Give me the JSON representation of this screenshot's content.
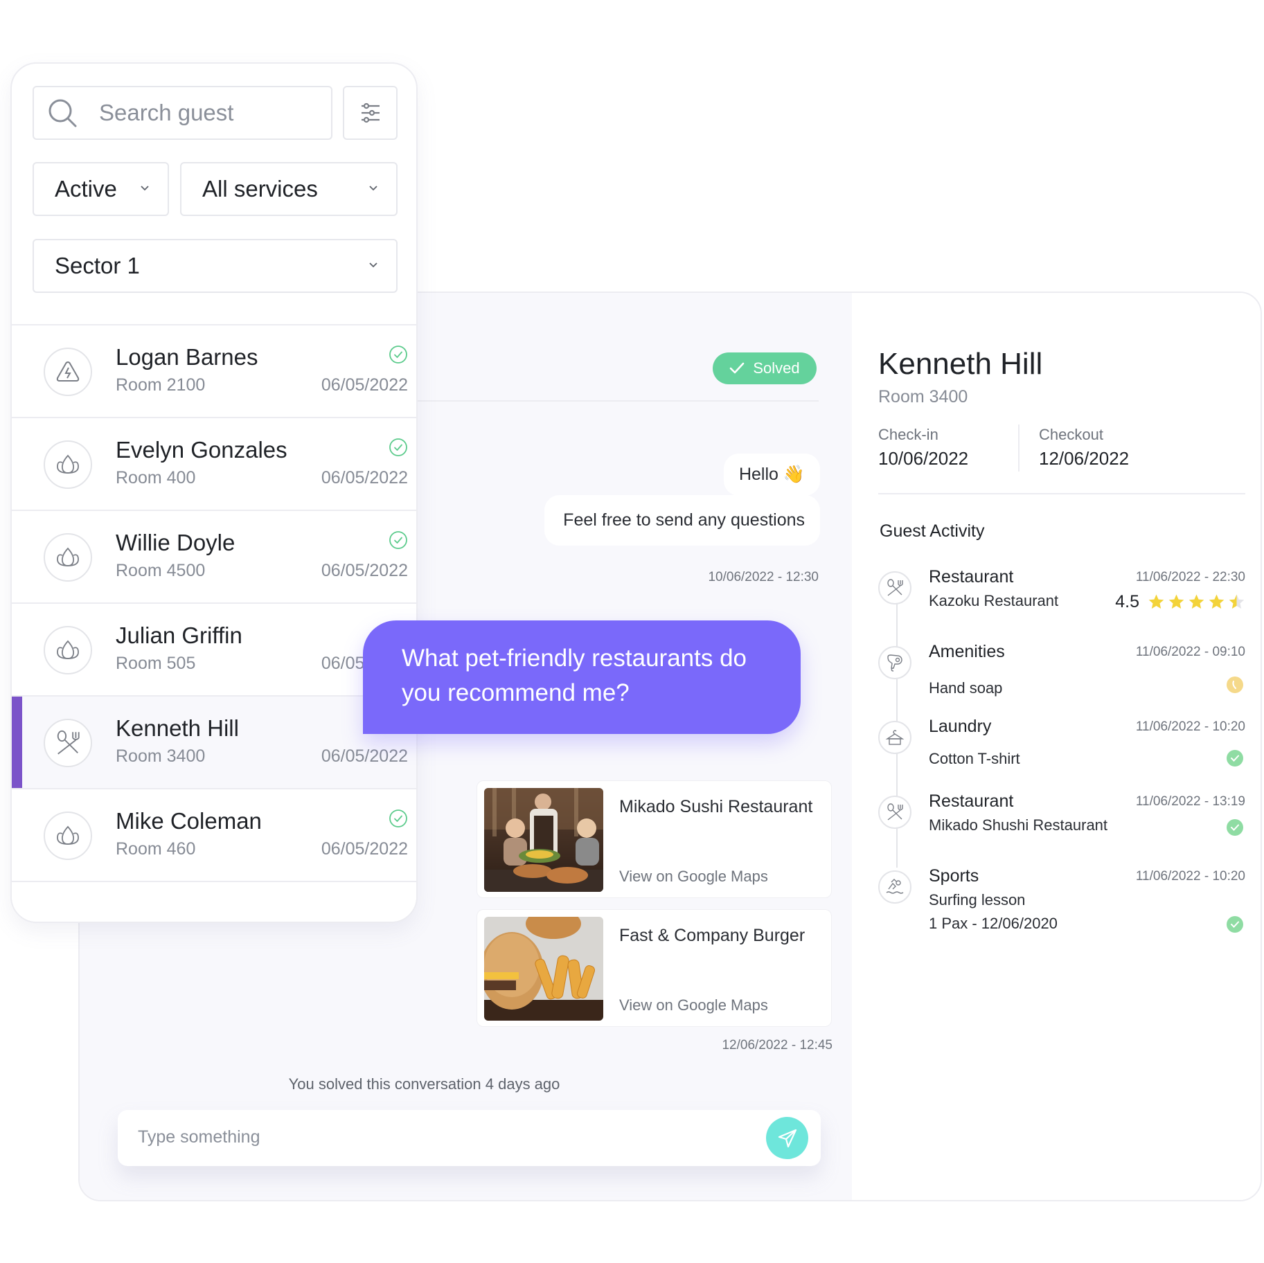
{
  "guest_panel": {
    "search": {
      "placeholder": "Search guest",
      "icon": "search-icon"
    },
    "filter_button": {
      "icon": "sliders-icon"
    },
    "filters": {
      "status": "Active",
      "services": "All services",
      "sector": "Sector 1"
    },
    "guests": [
      {
        "name": "Logan Barnes",
        "room": "Room 2100",
        "date": "06/05/2022",
        "icon": "electricity-icon",
        "solved": true,
        "selected": false
      },
      {
        "name": "Evelyn Gonzales",
        "room": "Room 400",
        "date": "06/05/2022",
        "icon": "lotus-icon",
        "solved": true,
        "selected": false
      },
      {
        "name": "Willie Doyle",
        "room": "Room 4500",
        "date": "06/05/2022",
        "icon": "lotus-icon",
        "solved": true,
        "selected": false
      },
      {
        "name": "Julian Griffin",
        "room": "Room 505",
        "date": "06/05/2022",
        "icon": "lotus-icon",
        "solved": false,
        "selected": false
      },
      {
        "name": "Kenneth Hill",
        "room": "Room 3400",
        "date": "06/05/2022",
        "icon": "restaurant-icon",
        "solved": false,
        "selected": true
      },
      {
        "name": "Mike Coleman",
        "room": "Room 460",
        "date": "06/05/2022",
        "icon": "lotus-icon",
        "solved": true,
        "selected": false
      }
    ]
  },
  "chat": {
    "status_badge": "Solved",
    "messages": [
      {
        "text": "Hello 👋"
      },
      {
        "text": "Feel free to send any questions"
      }
    ],
    "timestamp_1": "10/06/2022 - 12:30",
    "guest_message": "What pet-friendly restaurants do you recommend me?",
    "recommendations": [
      {
        "name": "Mikado Sushi Restaurant",
        "link": "View on Google Maps",
        "image": "restaurant-photo"
      },
      {
        "name": "Fast & Company Burger",
        "link": "View on Google Maps",
        "image": "burger-photo"
      }
    ],
    "timestamp_2": "12/06/2022 - 12:45",
    "solved_note": "You solved this conversation 4 days ago",
    "input_placeholder": "Type something"
  },
  "guest_details": {
    "name": "Kenneth Hill",
    "room": "Room 3400",
    "checkin_label": "Check-in",
    "checkin_date": "10/06/2022",
    "checkout_label": "Checkout",
    "checkout_date": "12/06/2022",
    "activity_title": "Guest Activity",
    "activities": [
      {
        "type": "Restaurant",
        "icon": "restaurant-icon",
        "time": "11/06/2022 - 22:30",
        "detail": "Kazoku Restaurant",
        "rating": "4.5",
        "rating_value": 4.5,
        "rating_max": 5
      },
      {
        "type": "Amenities",
        "icon": "hair-dryer-icon",
        "time": "11/06/2022 - 09:10",
        "detail": "Hand soap",
        "status": "pending"
      },
      {
        "type": "Laundry",
        "icon": "hanger-icon",
        "time": "11/06/2022 - 10:20",
        "detail": "Cotton T-shirt",
        "status": "done"
      },
      {
        "type": "Restaurant",
        "icon": "restaurant-icon",
        "time": "11/06/2022 - 13:19",
        "detail": "Mikado Shushi Restaurant",
        "status": "done"
      },
      {
        "type": "Sports",
        "icon": "swimming-icon",
        "time": "11/06/2022 - 10:20",
        "detail": "Surfing lesson",
        "detail_2": "1 Pax - 12/06/2020",
        "status": "done"
      }
    ]
  },
  "colors": {
    "accent_purple": "#7b53c9",
    "message_bubble": "#7a69fa",
    "solved_green": "#64d29c",
    "send_teal": "#6ee6db",
    "star_yellow": "#f3d33a"
  }
}
